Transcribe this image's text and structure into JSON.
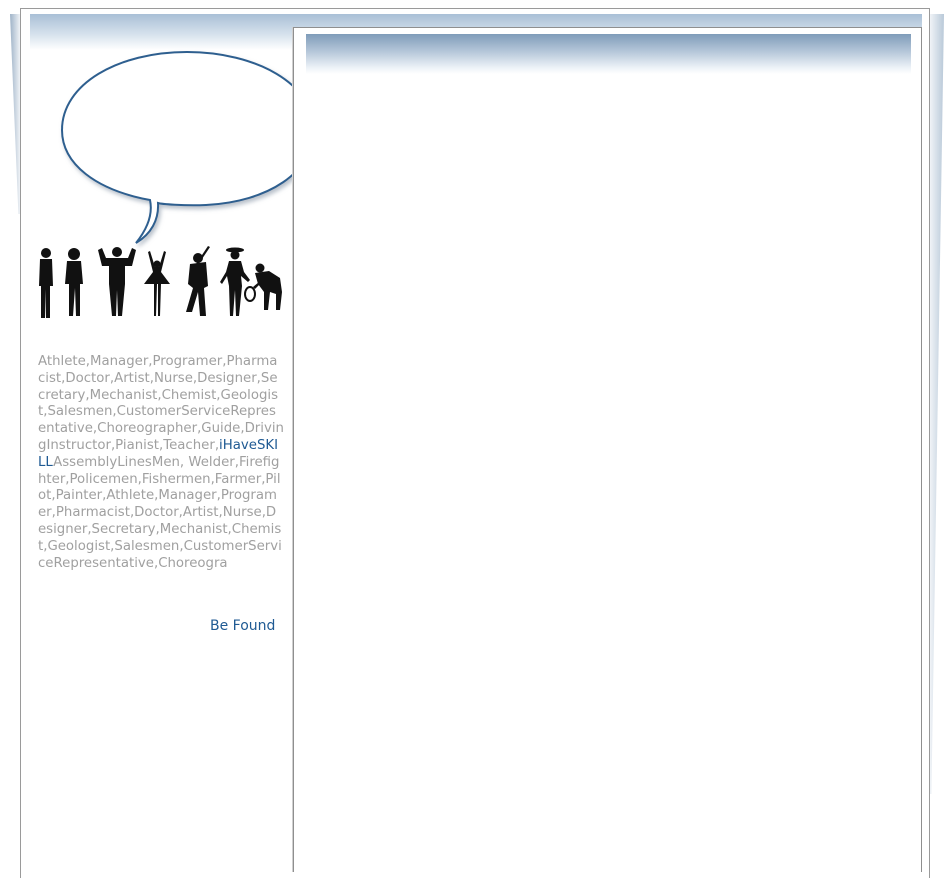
{
  "sidebar": {
    "skills_part1": "Athlete,Manager,Programer,Pharmacist,Doctor,Artist,Nurse,Designer,Secretary,Mechanist,Chemist,Geologist,Salesmen,CustomerServiceRepresentative,Choreographer,Guide,DrivingInstructor,Pianist,Teacher,",
    "brand_link": "iHaveSKILL",
    "skills_part2": "AssemblyLinesMen, Welder,Firefighter,Policemen,Fishermen,Farmer,Pilot,Painter,Athlete,Manager,Programer,Pharmacist,Doctor,Artist,Nurse,Designer,Secretary,Mechanist,Chemist,Geologist,Salesmen,CustomerServiceRepresentative,Choreogra",
    "be_found_link": "Be Found"
  },
  "colors": {
    "link": "#1f5a93",
    "muted_text": "#a0a0a0",
    "bubble_stroke": "#2e5f8f",
    "header_band": "#7f9cb9"
  },
  "icons": {
    "speech_bubble": "speech-bubble-icon",
    "people": "people-silhouettes-icon"
  }
}
